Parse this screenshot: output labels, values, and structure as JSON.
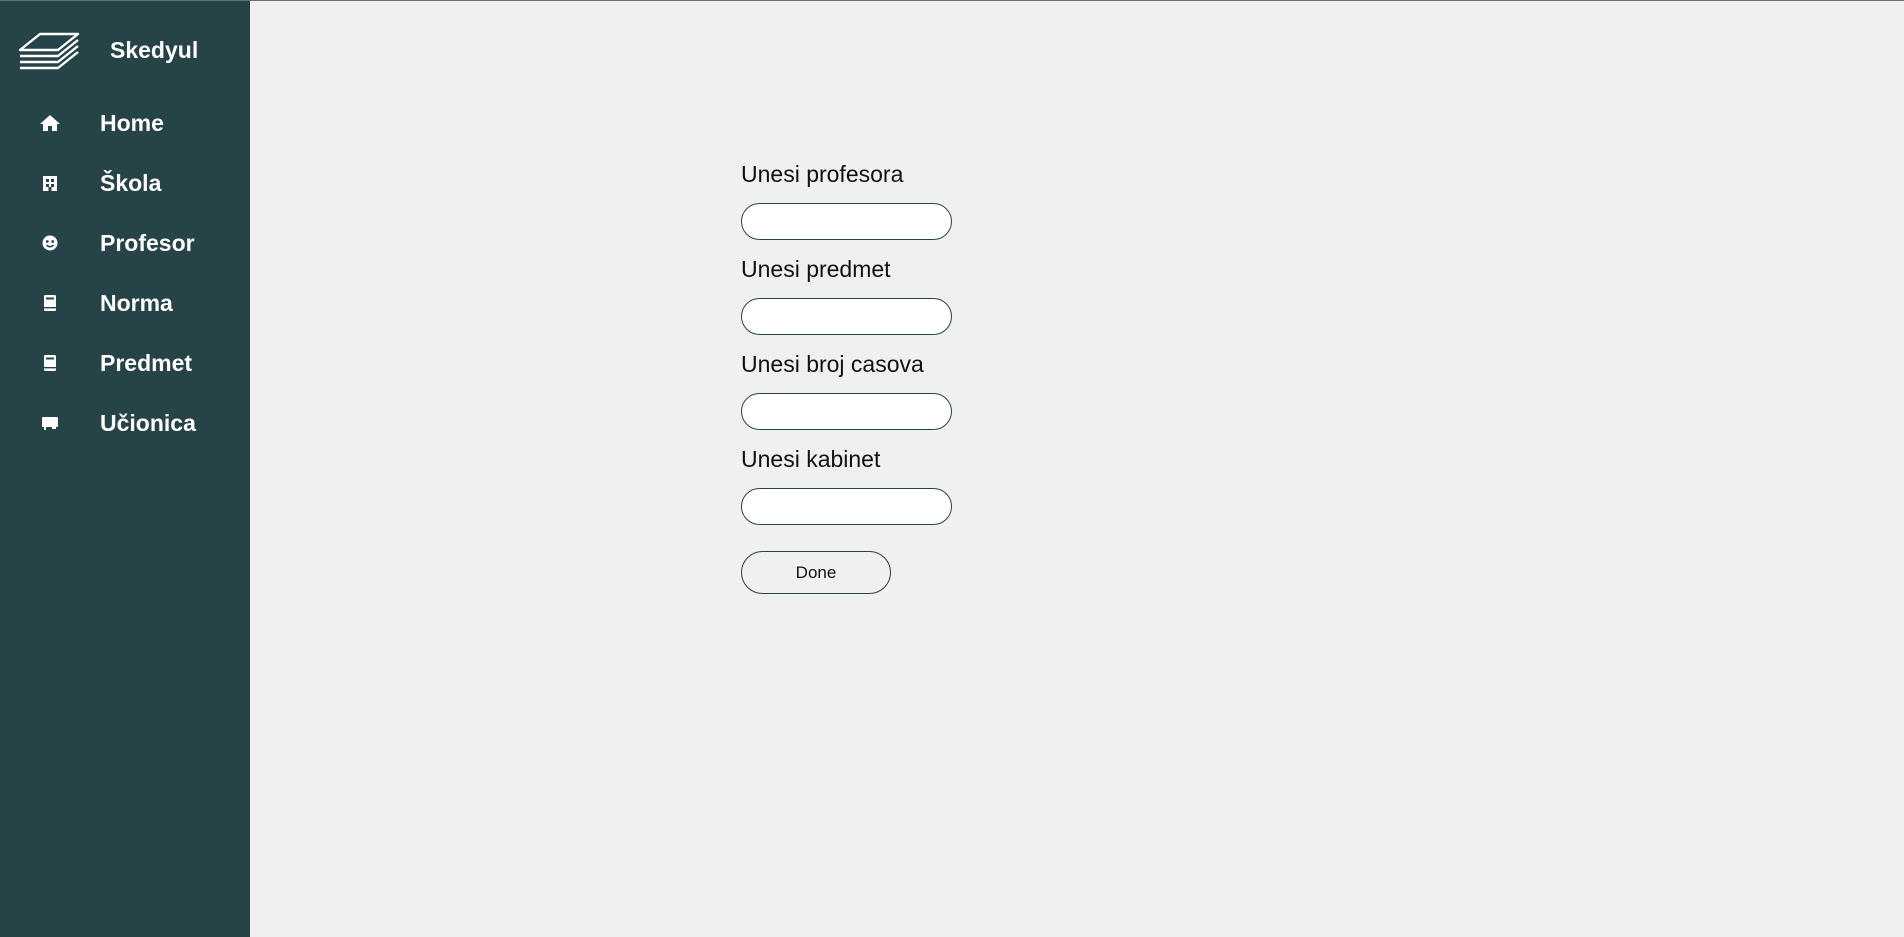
{
  "brand": {
    "name": "Skedyul",
    "logo_icon": "layers-icon"
  },
  "sidebar": {
    "items": [
      {
        "label": "Home",
        "icon": "home-icon"
      },
      {
        "label": "Škola",
        "icon": "building-icon"
      },
      {
        "label": "Profesor",
        "icon": "face-icon"
      },
      {
        "label": "Norma",
        "icon": "book-icon"
      },
      {
        "label": "Predmet",
        "icon": "book-icon"
      },
      {
        "label": "Učionica",
        "icon": "chalkboard-icon"
      }
    ]
  },
  "form": {
    "fields": [
      {
        "label": "Unesi profesora",
        "value": "",
        "placeholder": ""
      },
      {
        "label": "Unesi predmet",
        "value": "",
        "placeholder": ""
      },
      {
        "label": "Unesi broj casova",
        "value": "",
        "placeholder": ""
      },
      {
        "label": "Unesi kabinet",
        "value": "",
        "placeholder": ""
      }
    ],
    "submit_label": "Done"
  },
  "colors": {
    "sidebar_background": "#264348",
    "page_background": "#f0f0f0",
    "text_on_sidebar": "#ffffff",
    "input_border": "#264348"
  }
}
